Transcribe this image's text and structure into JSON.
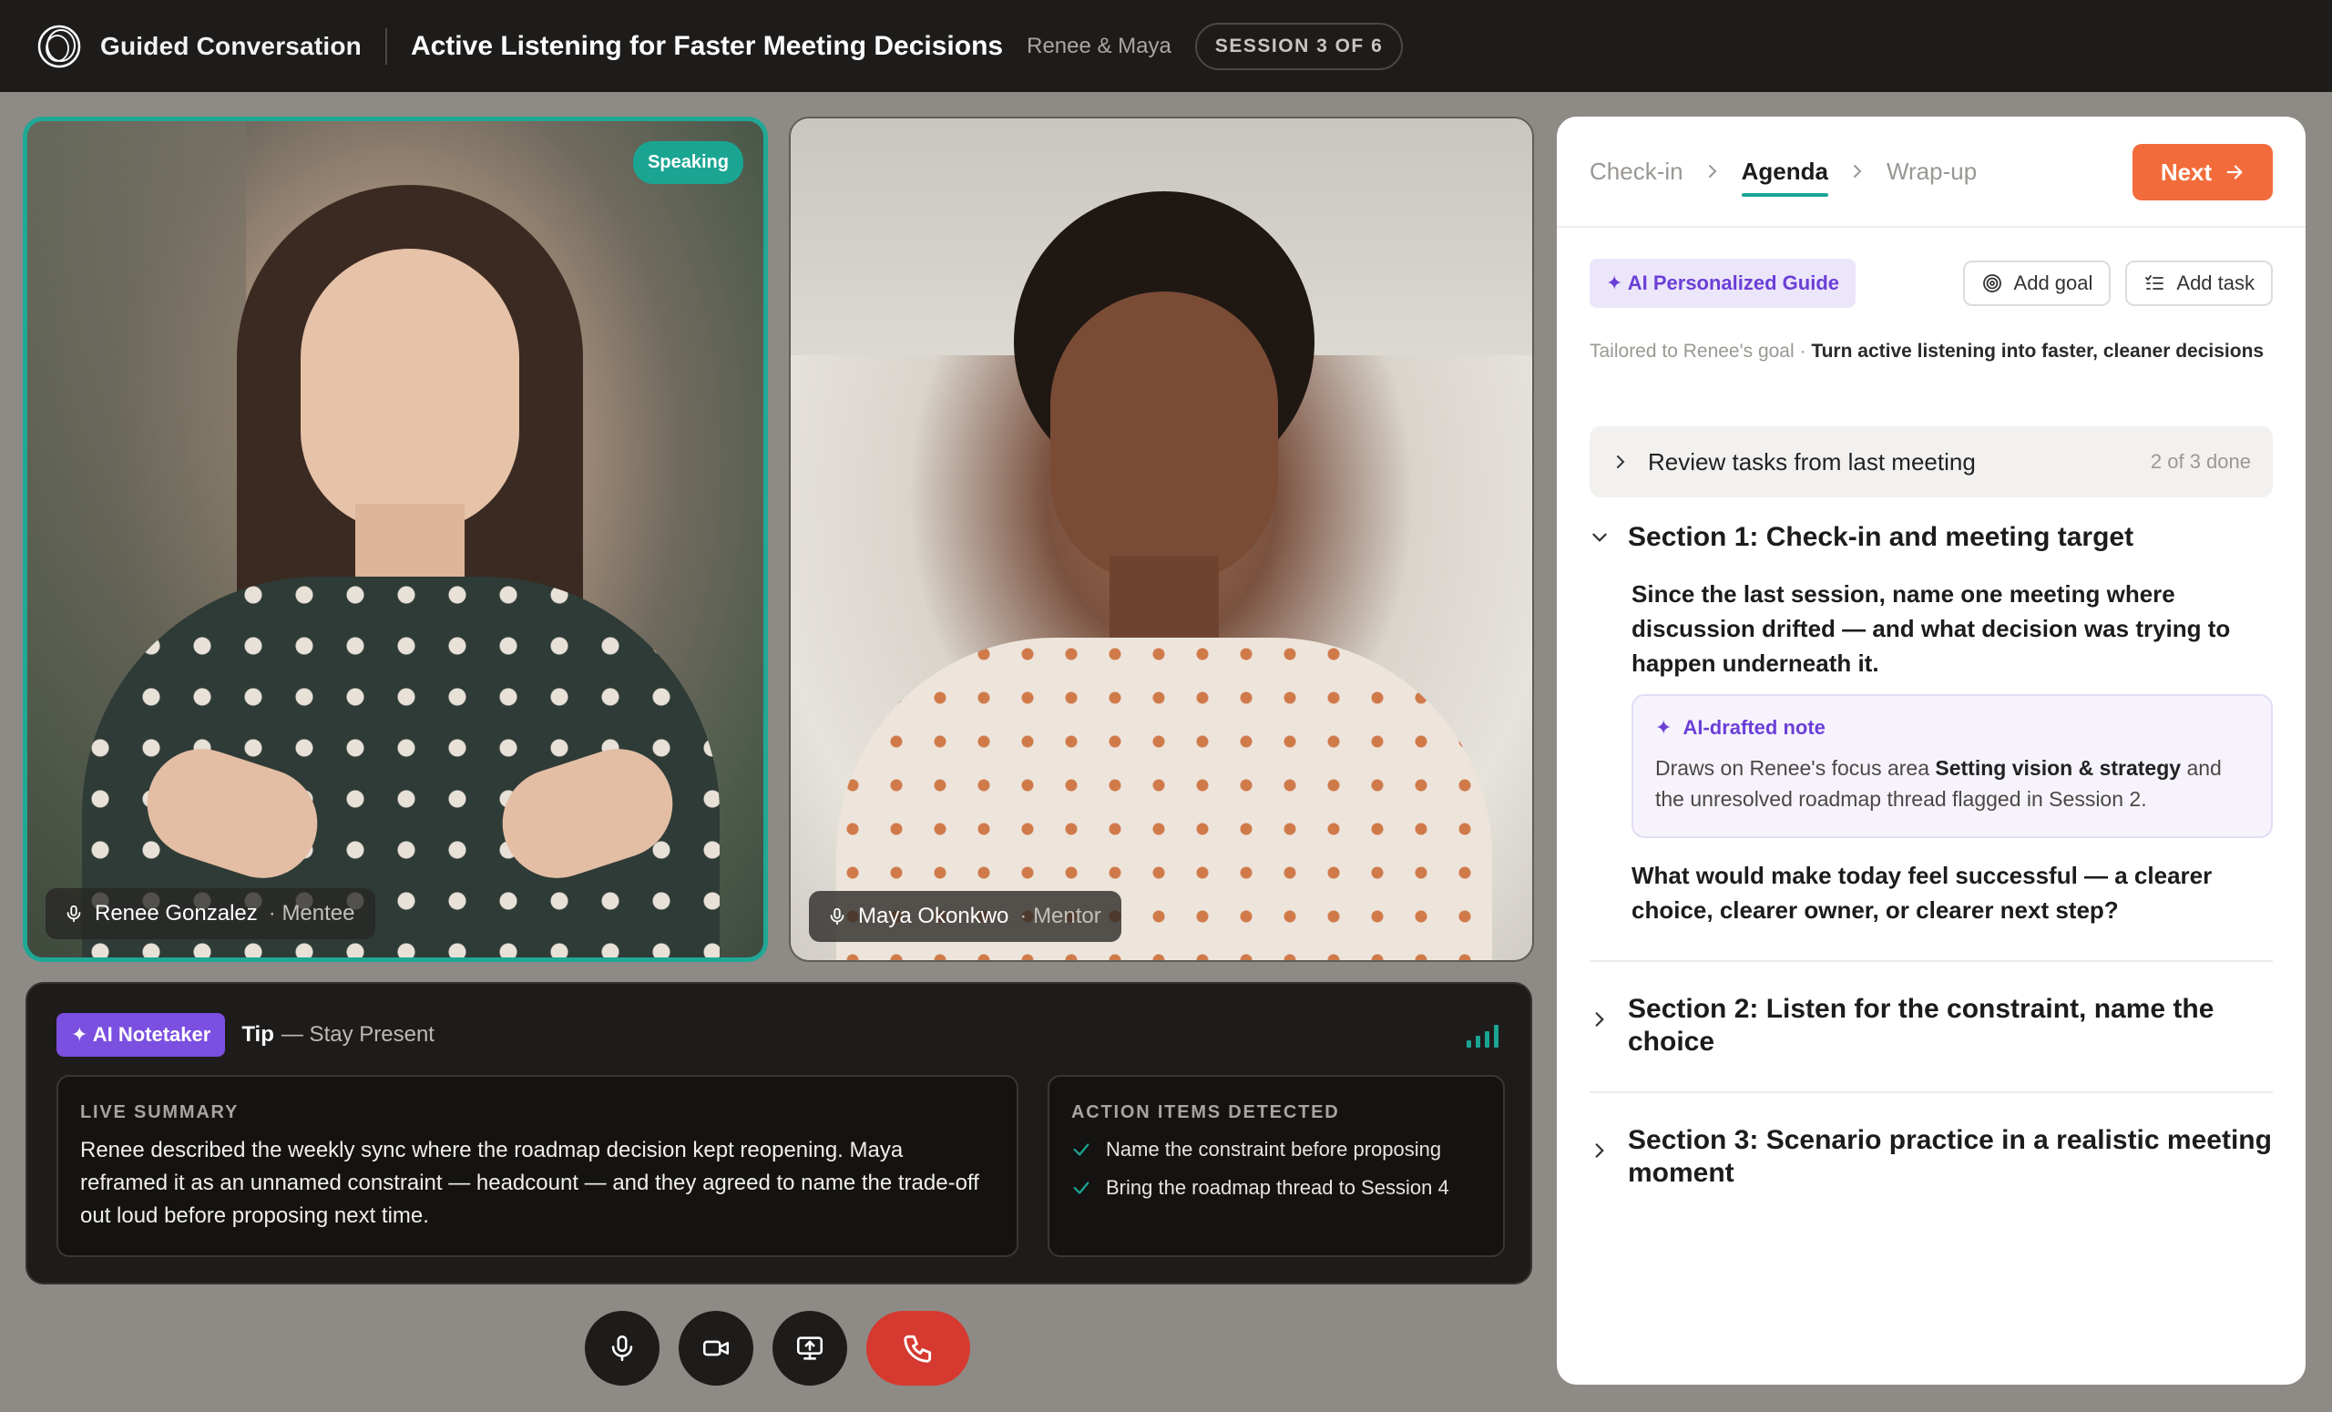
{
  "topbar": {
    "app_name": "Guided Conversation",
    "session_title": "Active Listening for Faster Meeting Decisions",
    "participants": "Renee & Maya",
    "session_badge": "SESSION 3 OF 6"
  },
  "videos": {
    "renee": {
      "name": "Renee Gonzalez",
      "role": "· Mentee",
      "status": "Speaking"
    },
    "maya": {
      "name": "Maya Okonkwo",
      "role": "· Mentor"
    }
  },
  "notetaker": {
    "badge": "✦ AI Notetaker",
    "tip_label": "Tip",
    "tip_text": "— Stay Present",
    "summary_label": "LIVE SUMMARY",
    "summary_text": "Renee described the weekly sync where the roadmap decision kept reopening. Maya reframed it as an unnamed constraint — headcount — and they agreed to name the trade-off out loud before proposing next time.",
    "actions_label": "ACTION ITEMS DETECTED",
    "actions": [
      "Name the constraint before proposing",
      "Bring the roadmap thread to Session 4"
    ]
  },
  "controls": {
    "icons": [
      "mic-icon",
      "camera-icon",
      "screen-share-icon",
      "phone-end-icon"
    ]
  },
  "panel": {
    "steps": [
      "Check-in",
      "Agenda",
      "Wrap-up"
    ],
    "active_step": "Agenda",
    "next_label": "Next",
    "guide_badge": "✦ AI Personalized Guide",
    "add_goal": "Add goal",
    "add_task": "Add task",
    "tailored_prefix": "Tailored to Renee's goal ·",
    "tailored_goal": "Turn active listening into faster, cleaner decisions",
    "review": {
      "label": "Review tasks from last meeting",
      "count": "2 of 3 done"
    },
    "section1": {
      "title": "Section 1: Check-in and meeting target",
      "question": "Since the last session, name one meeting where discussion drifted — and what decision was trying to happen underneath it.",
      "note_title": "AI-drafted note",
      "note_pre": "Draws on Renee's focus area",
      "note_bold": "Setting vision & strategy",
      "note_post": "and the unresolved roadmap thread flagged in Session 2.",
      "question2": "What would make today feel successful — a clearer choice, clearer owner, or clearer next step?"
    },
    "section2": {
      "title": "Section 2: Listen for the constraint, name the choice"
    },
    "section3": {
      "title": "Section 3: Scenario practice in a realistic meeting moment"
    }
  },
  "colors": {
    "accent_teal": "#1aa593",
    "next_orange": "#f26b3a",
    "ai_purple": "#7b4fe0",
    "end_call_red": "#d5392f"
  }
}
